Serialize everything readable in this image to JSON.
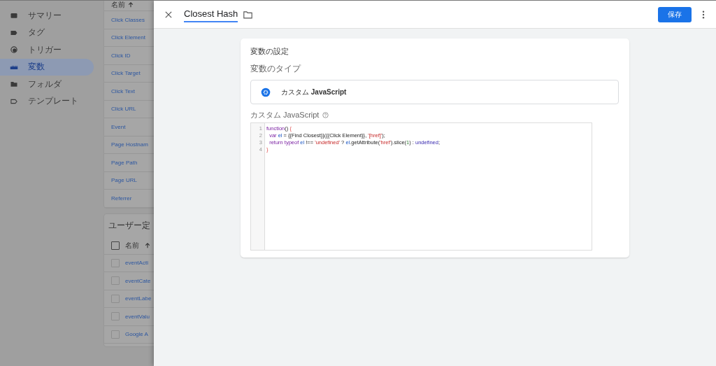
{
  "sidebar": {
    "items": [
      {
        "label": "サマリー",
        "selected": false
      },
      {
        "label": "タグ",
        "selected": false
      },
      {
        "label": "トリガー",
        "selected": false
      },
      {
        "label": "変数",
        "selected": true
      },
      {
        "label": "フォルダ",
        "selected": false
      },
      {
        "label": "テンプレート",
        "selected": false
      }
    ]
  },
  "builtin_variables": {
    "header": "名前",
    "rows": [
      "Click Classes",
      "Click Element",
      "Click ID",
      "Click Target",
      "Click Text",
      "Click URL",
      "Event",
      "Page Hostnam",
      "Page Path",
      "Page URL",
      "Referrer"
    ]
  },
  "user_defined_variables": {
    "title": "ユーザー定",
    "header": "名前",
    "header_checked": false,
    "rows": [
      {
        "label": "eventActi",
        "checked": false
      },
      {
        "label": "eventCate",
        "checked": false
      },
      {
        "label": "eventLabe",
        "checked": false
      },
      {
        "label": "eventValu",
        "checked": false
      },
      {
        "label": "Google A",
        "checked": false
      }
    ]
  },
  "editor": {
    "title": "Closest Hash",
    "save_label": "保存",
    "card_title": "変数の設定",
    "type_label": "変数のタイプ",
    "type_value": "カスタム **JavaScript**",
    "code_label": "カスタム JavaScript",
    "code_lines": [
      {
        "number": "1",
        "tokens": [
          {
            "kind": "keyword",
            "text": "function"
          },
          {
            "kind": "plain",
            "text": "() "
          },
          {
            "kind": "bracket",
            "text": "{"
          }
        ]
      },
      {
        "number": "2",
        "tokens": [
          {
            "kind": "keyword",
            "text": "  var"
          },
          {
            "kind": "variable",
            "text": " el"
          },
          {
            "kind": "plain",
            "text": " = {{Find Closest}}({{Click Element}}, "
          },
          {
            "kind": "string",
            "text": "'[href]'"
          },
          {
            "kind": "plain",
            "text": ");"
          }
        ]
      },
      {
        "number": "3",
        "tokens": [
          {
            "kind": "keyword",
            "text": "  return typeof"
          },
          {
            "kind": "variable",
            "text": " el"
          },
          {
            "kind": "plain",
            "text": " !== "
          },
          {
            "kind": "string",
            "text": "'undefined'"
          },
          {
            "kind": "plain",
            "text": " ? "
          },
          {
            "kind": "variable",
            "text": "el"
          },
          {
            "kind": "plain",
            "text": ".getAttribute("
          },
          {
            "kind": "string",
            "text": "'href'"
          },
          {
            "kind": "plain",
            "text": ").slice("
          },
          {
            "kind": "number",
            "text": "1"
          },
          {
            "kind": "plain",
            "text": ") : "
          },
          {
            "kind": "atom",
            "text": "undefined"
          },
          {
            "kind": "plain",
            "text": ";"
          }
        ]
      },
      {
        "number": "4",
        "tokens": [
          {
            "kind": "bracket",
            "text": "}"
          }
        ]
      }
    ]
  }
}
